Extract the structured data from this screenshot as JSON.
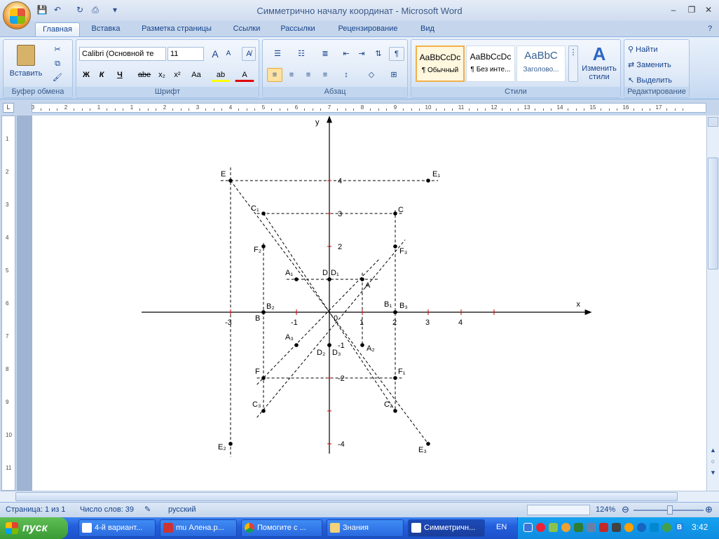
{
  "window": {
    "title": "Симметрично началу координат - Microsoft Word"
  },
  "tabs": [
    "Главная",
    "Вставка",
    "Разметка страницы",
    "Ссылки",
    "Рассылки",
    "Рецензирование",
    "Вид"
  ],
  "ribbon": {
    "clipboard": {
      "label": "Буфер обмена",
      "paste": "Вставить"
    },
    "font": {
      "label": "Шрифт",
      "name": "Calibri (Основной те",
      "size": "11",
      "bold": "Ж",
      "italic": "К",
      "underline": "Ч",
      "strike": "abe",
      "sub": "x₂",
      "sup": "x²",
      "case": "Aa",
      "grow": "A",
      "shrink": "A"
    },
    "paragraph": {
      "label": "Абзац"
    },
    "styles": {
      "label": "Стили",
      "items": [
        {
          "preview": "AaBbCcDc",
          "name": "¶ Обычный"
        },
        {
          "preview": "AaBbCcDc",
          "name": "¶ Без инте..."
        },
        {
          "preview": "AaBbC",
          "name": "Заголово..."
        }
      ],
      "change": "Изменить стили"
    },
    "editing": {
      "label": "Редактирование",
      "find": "Найти",
      "replace": "Заменить",
      "select": "Выделить"
    }
  },
  "ruler": {
    "numbers": [
      "3",
      "2",
      "1",
      "1",
      "2",
      "3",
      "4",
      "5",
      "6",
      "7",
      "8",
      "9",
      "10",
      "11",
      "12",
      "13",
      "14",
      "15",
      "16",
      "17"
    ]
  },
  "vruler": {
    "numbers": [
      "1",
      "2",
      "3",
      "4",
      "5",
      "6",
      "7",
      "8",
      "9",
      "10",
      "11"
    ]
  },
  "chart_data": {
    "type": "scatter",
    "xlabel": "x",
    "ylabel": "y",
    "xlim": [
      -5,
      5
    ],
    "ylim": [
      -4.5,
      6
    ],
    "x_ticks": [
      -3,
      -1,
      1,
      2,
      3,
      4
    ],
    "y_ticks": [
      4,
      3,
      2,
      -1,
      -2,
      -4
    ],
    "origin_label": "0",
    "points": [
      {
        "name": "E",
        "x": -3,
        "y": 4
      },
      {
        "name": "E₁",
        "x": 3,
        "y": 4
      },
      {
        "name": "C₁",
        "x": -2,
        "y": 3
      },
      {
        "name": "C",
        "x": 2,
        "y": 3
      },
      {
        "name": "F₂",
        "x": -2,
        "y": 2
      },
      {
        "name": "F₃",
        "x": 2,
        "y": 2
      },
      {
        "name": "A₁",
        "x": -1,
        "y": 1
      },
      {
        "name": "D",
        "x": 0,
        "y": 1
      },
      {
        "name": "D₁",
        "x": 0,
        "y": 1
      },
      {
        "name": "A",
        "x": 1,
        "y": 1
      },
      {
        "name": "B₂",
        "x": -2,
        "y": 0
      },
      {
        "name": "B",
        "x": -2,
        "y": 0
      },
      {
        "name": "B₁",
        "x": 2,
        "y": 0
      },
      {
        "name": "B₃",
        "x": 2,
        "y": 0
      },
      {
        "name": "A₃",
        "x": -1,
        "y": -1
      },
      {
        "name": "A₂",
        "x": 1,
        "y": -1
      },
      {
        "name": "D₂",
        "x": 0,
        "y": -1
      },
      {
        "name": "D₃",
        "x": 0,
        "y": -1
      },
      {
        "name": "F",
        "x": -2,
        "y": -2
      },
      {
        "name": "F₁",
        "x": 2,
        "y": -2
      },
      {
        "name": "C₃",
        "x": -2,
        "y": -3
      },
      {
        "name": "C₂",
        "x": 2,
        "y": -3
      },
      {
        "name": "E₂",
        "x": -3,
        "y": -4
      },
      {
        "name": "E₃",
        "x": 3,
        "y": -4
      }
    ]
  },
  "status": {
    "page": "Страница: 1 из 1",
    "words": "Число слов: 39",
    "lang": "русский",
    "zoom": "124%"
  },
  "taskbar": {
    "start": "пуск",
    "tasks": [
      "4-й вариант...",
      "mu Алена.р...",
      "Помогите с ...",
      "Знания",
      "Симметричн..."
    ],
    "lang": "EN",
    "time": "3:42"
  }
}
